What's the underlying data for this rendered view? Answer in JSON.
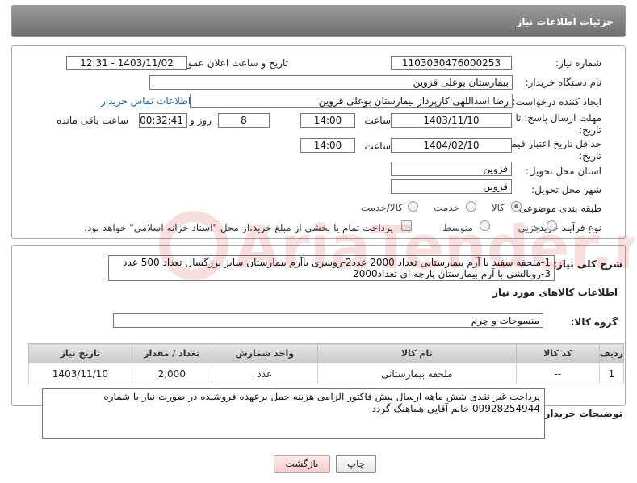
{
  "header": {
    "title": "جزئیات اطلاعات نیاز"
  },
  "form": {
    "need_number_label": "شماره نیاز:",
    "need_number": "1103030476000253",
    "announce_label": "تاریخ و ساعت اعلان عمومی:",
    "announce_value": "1403/11/02 - 12:31",
    "buyer_org_label": "نام دستگاه خریدار:",
    "buyer_org": "بیمارستان بوعلی قزوین",
    "requester_label": "ایجاد کننده درخواست:",
    "requester": "رضا اسداللهی کارپرداز بیمارستان بوعلی قزوین",
    "contact_link": "اطلاعات تماس خریدار",
    "deadline_label_1": "مهلت ارسال پاسخ: تا",
    "deadline_label_2": "تاریخ:",
    "deadline_date": "1403/11/10",
    "time_label": "ساعت",
    "deadline_time": "14:00",
    "days_value": "8",
    "days_label": "روز و",
    "remaining_time": "00:32:41",
    "remaining_label": "ساعت باقی مانده",
    "validity_label_1": "حداقل تاریخ اعتبار قیمت: تا",
    "validity_label_2": "تاریخ:",
    "validity_date": "1404/02/10",
    "validity_time": "14:00",
    "province_label": "استان محل تحویل:",
    "province": "قزوین",
    "city_label": "شهر محل تحویل:",
    "city": "قزوین",
    "category_label": "طبقه بندی موضوعی:",
    "category_options": [
      "کالا",
      "خدمت",
      "کالا/خدمت"
    ],
    "process_label": "نوع فرآیند خرید :",
    "process_options": [
      "جزیی",
      "متوسط"
    ],
    "payment_note": "پرداخت تمام یا بخشی از مبلغ خرید،از محل \"اسناد خزانه اسلامی\" خواهد بود."
  },
  "description": {
    "label": "شرح کلی نیاز:",
    "text": "1-ملحفه سفید با آرم بیمارستانی تعداد 2000 عدد2-روسری  باآرم بیمارستان  سایز بزرگسال تعداد 500 عدد 3-روبالشی با آرم بیمارستان پارچه ای تعداد2000"
  },
  "goods": {
    "section_title": "اطلاعات کالاهای مورد نیاز",
    "group_label": "گروه کالا:",
    "group_value": "منسوجات و چرم",
    "table": {
      "headers": [
        "ردیف",
        "کد کالا",
        "نام کالا",
        "واحد شمارش",
        "تعداد / مقدار",
        "تاریخ نیاز"
      ],
      "rows": [
        [
          "1",
          "--",
          "ملحفه بیمارستانی",
          "عدد",
          "2,000",
          "1403/11/10"
        ]
      ]
    }
  },
  "buyer_notes": {
    "label": "توضیحات خریدار:",
    "text": "پرداخت غیر نقدی شش ماهه ارسال پیش فاکتور الزامی هزینه حمل برعهده فروشنده در صورت نیاز با شماره 09928254944 خانم آقایی هماهنگ گردد"
  },
  "buttons": {
    "print": "چاپ",
    "back": "بازگشت"
  },
  "watermark": {
    "text": "AriaTender.neT"
  }
}
